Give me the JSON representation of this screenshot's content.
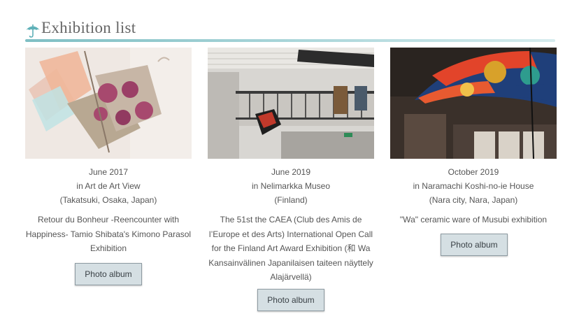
{
  "header": {
    "title": "Exhibition list",
    "icon": "umbrella-icon",
    "accent_color": "#7fbfc4"
  },
  "exhibitions": [
    {
      "date": "June 2017",
      "venue": "in Art de Art View",
      "location": "(Takatsuki, Osaka, Japan)",
      "description": "Retour du Bonheur -Reencounter with Happiness- Tamio Shibata's Kimono Parasol Exhibition",
      "button_label": "Photo album"
    },
    {
      "date": "June 2019",
      "venue": "in Nelimarkka Museo",
      "location": "(Finland)",
      "description": "The 51st the CAEA (Club des Amis de l’Europe et des Arts) International Open Call for the Finland Art Award Exhibition (和 Wa Kansainvälinen Japanilaisen taiteen näyttely Alajärvellä)",
      "button_label": "Photo album"
    },
    {
      "date": "October 2019",
      "venue": "in Naramachi Koshi-no-ie House",
      "location": "(Nara city, Nara, Japan)",
      "description": "\"Wa\" ceramic ware of Musubi exhibition",
      "button_label": "Photo album"
    }
  ]
}
